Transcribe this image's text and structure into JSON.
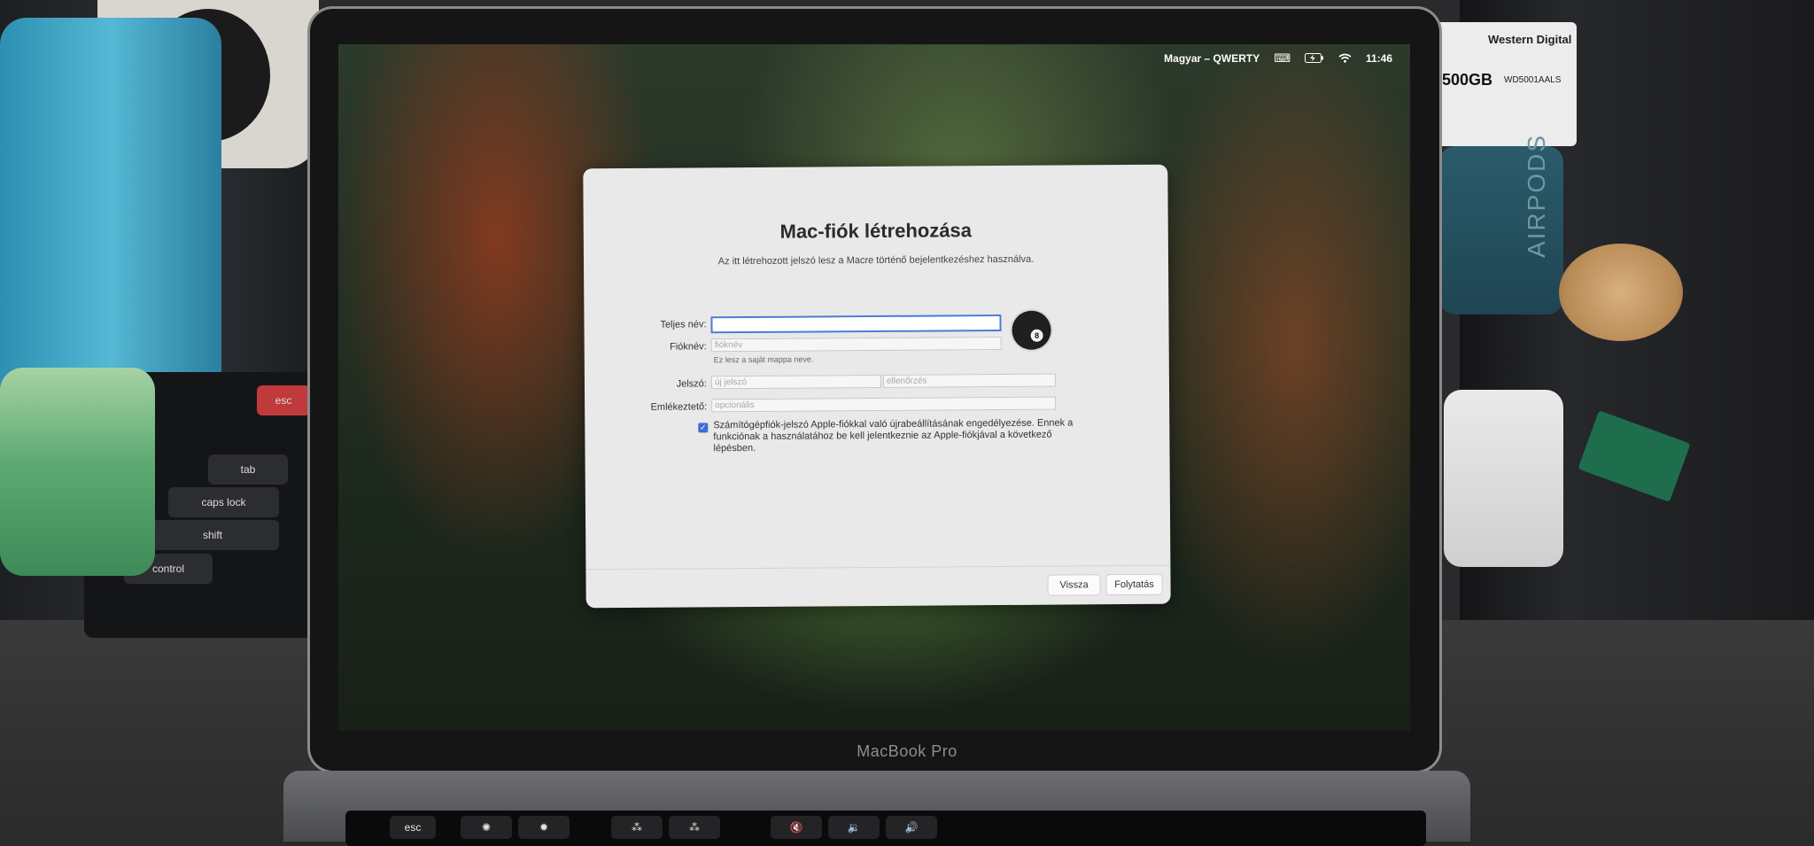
{
  "menubar": {
    "keyboard_layout": "Magyar – QWERTY",
    "time": "11:46",
    "icons": [
      "keyboard-icon",
      "battery-charging-icon",
      "wifi-icon"
    ]
  },
  "dialog": {
    "title": "Mac-fiók létrehozása",
    "subtitle": "Az itt létrehozott jelszó lesz a Macre történő bejelentkezéshez használva.",
    "full_name": {
      "label": "Teljes név:",
      "value": ""
    },
    "account_name": {
      "label": "Fióknév:",
      "placeholder": "fióknév",
      "hint": "Ez lesz a saját mappa neve."
    },
    "password": {
      "label": "Jelszó:",
      "placeholder": "új jelszó",
      "verify_placeholder": "ellenőrzés"
    },
    "password_hint": {
      "label": "Emlékeztető:",
      "placeholder": "opcionális"
    },
    "apple_reset": {
      "checked": true,
      "label": "Számítógépfiók-jelszó Apple-fiókkal való újrabeállításának engedélyezése. Ennek a funkciónak a használatához be kell jelentkeznie az Apple-fiókjával a következő lépésben."
    },
    "back_label": "Vissza",
    "continue_label": "Folytatás"
  },
  "laptop": {
    "brand": "MacBook Pro"
  },
  "touchbar": {
    "esc_label": "esc"
  },
  "keyboard": {
    "esc": "esc",
    "tab": "tab",
    "caps": "caps lock",
    "shift": "shift",
    "control": "control"
  },
  "hdd_label": {
    "capacity": "500GB",
    "brand": "Western Digital",
    "model": "WD5001AALS"
  },
  "pods_label": "AIRPODS",
  "colors": {
    "accent": "#3b6fd4",
    "dialog_bg": "#e9e9e9"
  }
}
